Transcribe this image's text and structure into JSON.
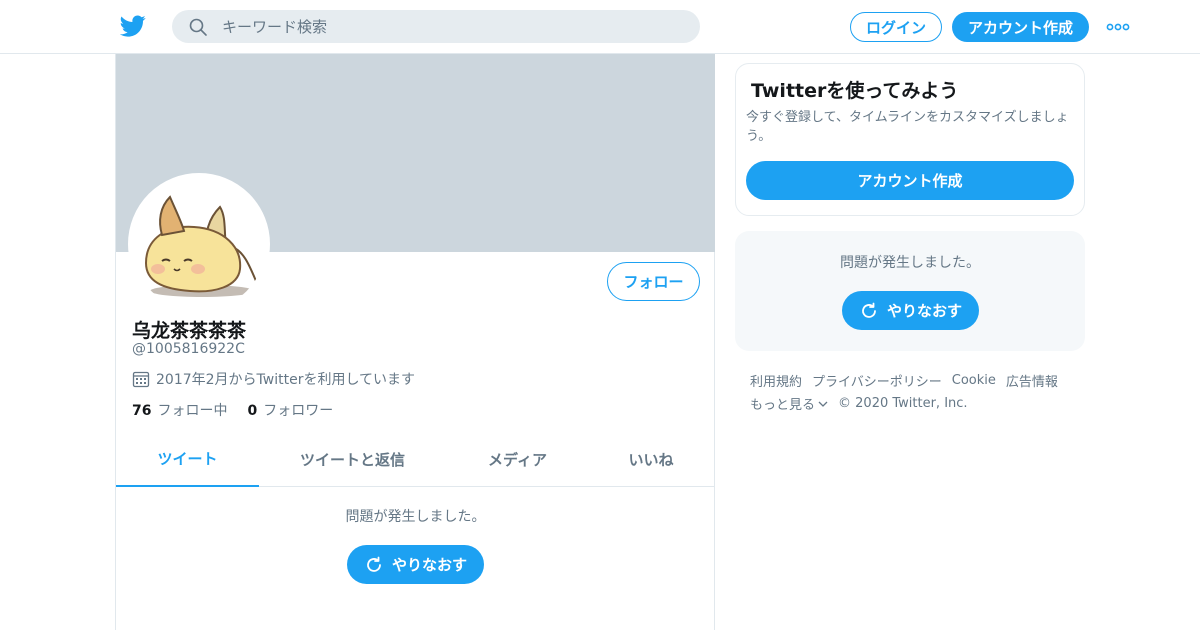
{
  "header": {
    "search_placeholder": "キーワード検索",
    "login_label": "ログイン",
    "signup_label": "アカウント作成"
  },
  "profile": {
    "display_name": "乌龙茶茶茶茶",
    "screen_name": "@1005816922C",
    "joined": "2017年2月からTwitterを利用しています",
    "following_count": "76",
    "following_label": "フォロー中",
    "followers_count": "0",
    "followers_label": "フォロワー",
    "follow_label": "フォロー"
  },
  "tabs": [
    {
      "label": "ツイート",
      "active": true
    },
    {
      "label": "ツイートと返信",
      "active": false
    },
    {
      "label": "メディア",
      "active": false
    },
    {
      "label": "いいね",
      "active": false
    }
  ],
  "timeline": {
    "error_text": "問題が発生しました。",
    "retry_label": "やりなおす"
  },
  "sidebar": {
    "signup_card": {
      "title": "Twitterを使ってみよう",
      "description": "今すぐ登録して、タイムラインをカスタマイズしましょう。",
      "button_label": "アカウント作成"
    },
    "error_card": {
      "error_text": "問題が発生しました。",
      "retry_label": "やりなおす"
    },
    "footer": {
      "links": [
        "利用規約",
        "プライバシーポリシー",
        "Cookie",
        "広告情報"
      ],
      "more_label": "もっと見る",
      "copyright": "© 2020 Twitter, Inc."
    }
  },
  "colors": {
    "accent": "#1da1f2",
    "banner": "#ccd6dd",
    "muted_text": "#657786"
  }
}
